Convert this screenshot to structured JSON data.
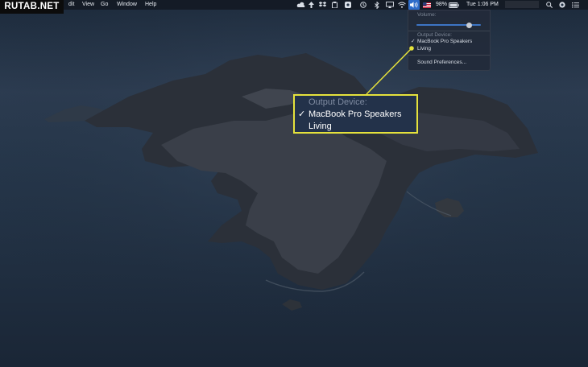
{
  "watermark": "RUTAB.NET",
  "menubar": {
    "menus": [
      "dit",
      "View",
      "Go",
      "Window",
      "Help"
    ],
    "battery_percent": "98%",
    "clock": "Tue 1:06 PM",
    "flag": "US"
  },
  "icons": [
    "cloud-icon",
    "dropbox-icon",
    "wifi-icon",
    "volume-icon",
    "bluetooth-icon",
    "battery-icon",
    "search-icon",
    "siri-icon",
    "list-icon"
  ],
  "sound_menu": {
    "volume_label": "Volume:",
    "volume_level": 0.82,
    "output_label": "Output Device:",
    "devices": [
      {
        "name": "MacBook Pro Speakers",
        "selected": true
      },
      {
        "name": "Living",
        "selected": false
      }
    ],
    "preferences": "Sound Preferences..."
  },
  "callout": {
    "heading": "Output Device:",
    "selected": "MacBook Pro Speakers",
    "other": "Living",
    "check": "✓"
  },
  "colors": {
    "callout_border": "#e5e23c",
    "selection_blue": "#2e6cc9"
  }
}
